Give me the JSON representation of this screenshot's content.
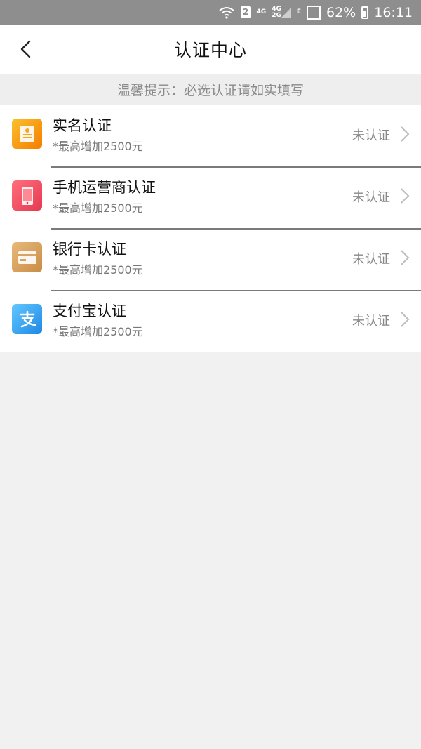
{
  "status_bar": {
    "sim_slot": "2",
    "net_a": "4G",
    "net_b_top": "4G",
    "net_b_bottom": "2G",
    "net_e": "E",
    "battery": "62%",
    "time": "16:11"
  },
  "header": {
    "title": "认证中心"
  },
  "tip": {
    "text": "温馨提示：必选认证请如实填写"
  },
  "items": [
    {
      "title": "实名认证",
      "subtitle": "*最高增加2500元",
      "status": "未认证",
      "icon": "id-card-icon",
      "color_a": "#fbc02d",
      "color_b": "#f57c00"
    },
    {
      "title": "手机运营商认证",
      "subtitle": "*最高增加2500元",
      "status": "未认证",
      "icon": "mobile-phone-icon",
      "color_a": "#ff6f7d",
      "color_b": "#e53950"
    },
    {
      "title": "银行卡认证",
      "subtitle": "*最高增加2500元",
      "status": "未认证",
      "icon": "bank-card-icon",
      "color_a": "#e8b97a",
      "color_b": "#c98c45"
    },
    {
      "title": "支付宝认证",
      "subtitle": "*最高增加2500元",
      "status": "未认证",
      "icon": "alipay-icon",
      "color_a": "#63c7ff",
      "color_b": "#1e88e5"
    }
  ]
}
